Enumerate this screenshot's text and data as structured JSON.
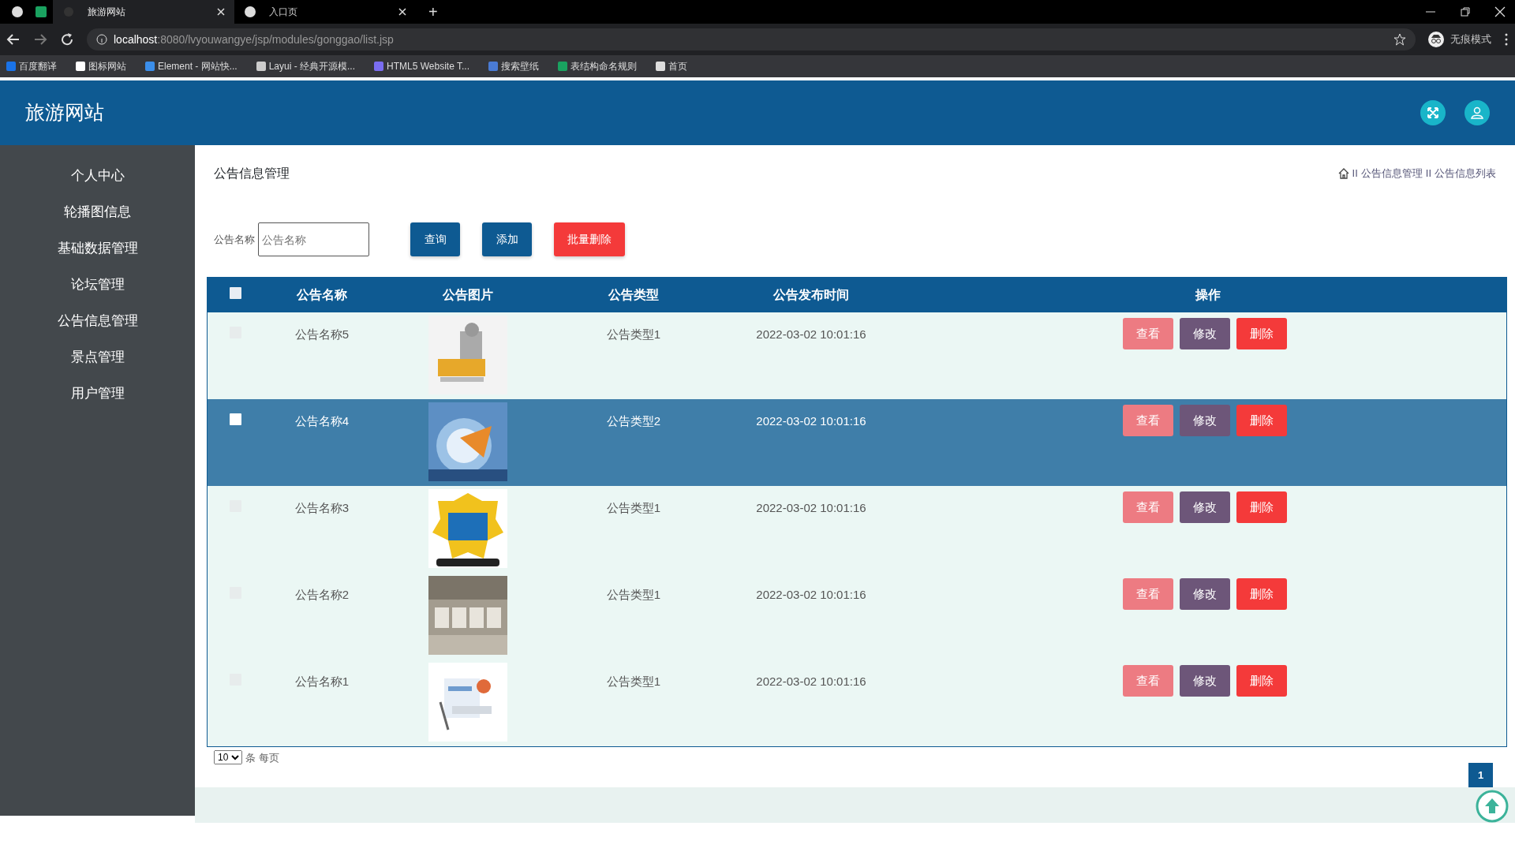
{
  "browser": {
    "tabs": [
      {
        "title": "旅游网站",
        "selected": true
      },
      {
        "title": "入口页",
        "selected": false
      }
    ],
    "new_tab": "+",
    "url_host": "localhost",
    "url_rest": ":8080/lvyouwangye/jsp/modules/gonggao/list.jsp",
    "profile": "无痕模式",
    "bookmarks": [
      "百度翻译",
      "图标网站",
      "Element - 网站快...",
      "Layui - 经典开源模...",
      "HTML5 Website T...",
      "搜索壁纸",
      "表结构命名规则",
      "首页"
    ]
  },
  "header": {
    "title": "旅游网站"
  },
  "sidebar": {
    "items": [
      "个人中心",
      "轮播图信息",
      "基础数据管理",
      "论坛管理",
      "公告信息管理",
      "景点管理",
      "用户管理"
    ]
  },
  "page": {
    "title": "公告信息管理",
    "breadcrumb": [
      "公告信息管理",
      "公告信息列表"
    ],
    "breadcrumb_seps": [
      "II",
      "II"
    ]
  },
  "search": {
    "label": "公告名称",
    "placeholder": "公告名称",
    "buttons": [
      {
        "label": "查询",
        "kind": "primary"
      },
      {
        "label": "添加",
        "kind": "primary"
      },
      {
        "label": "批量删除",
        "kind": "danger"
      }
    ]
  },
  "table": {
    "columns": [
      "公告名称",
      "公告图片",
      "公告类型",
      "公告发布时间",
      "操作"
    ],
    "header_checked": false,
    "rows": [
      {
        "name": "公告名称5",
        "type": "公告类型1",
        "time": "2022-03-02 10:01:16",
        "checked": false,
        "selected": false,
        "actions": [
          "查看",
          "修改",
          "删除"
        ]
      },
      {
        "name": "公告名称4",
        "type": "公告类型2",
        "time": "2022-03-02 10:01:16",
        "checked": false,
        "selected": true,
        "actions": [
          "查看",
          "修改",
          "删除"
        ]
      },
      {
        "name": "公告名称3",
        "type": "公告类型1",
        "time": "2022-03-02 10:01:16",
        "checked": false,
        "selected": false,
        "actions": [
          "查看",
          "修改",
          "删除"
        ]
      },
      {
        "name": "公告名称2",
        "type": "公告类型1",
        "time": "2022-03-02 10:01:16",
        "checked": false,
        "selected": false,
        "actions": [
          "查看",
          "修改",
          "删除"
        ]
      },
      {
        "name": "公告名称1",
        "type": "公告类型1",
        "time": "2022-03-02 10:01:16",
        "checked": false,
        "selected": false,
        "actions": [
          "查看",
          "修改",
          "删除"
        ]
      }
    ]
  },
  "pagination": {
    "page_size": "10",
    "page_size_label": "条 每页",
    "pages": [
      {
        "label": "1",
        "selected": true
      }
    ]
  }
}
